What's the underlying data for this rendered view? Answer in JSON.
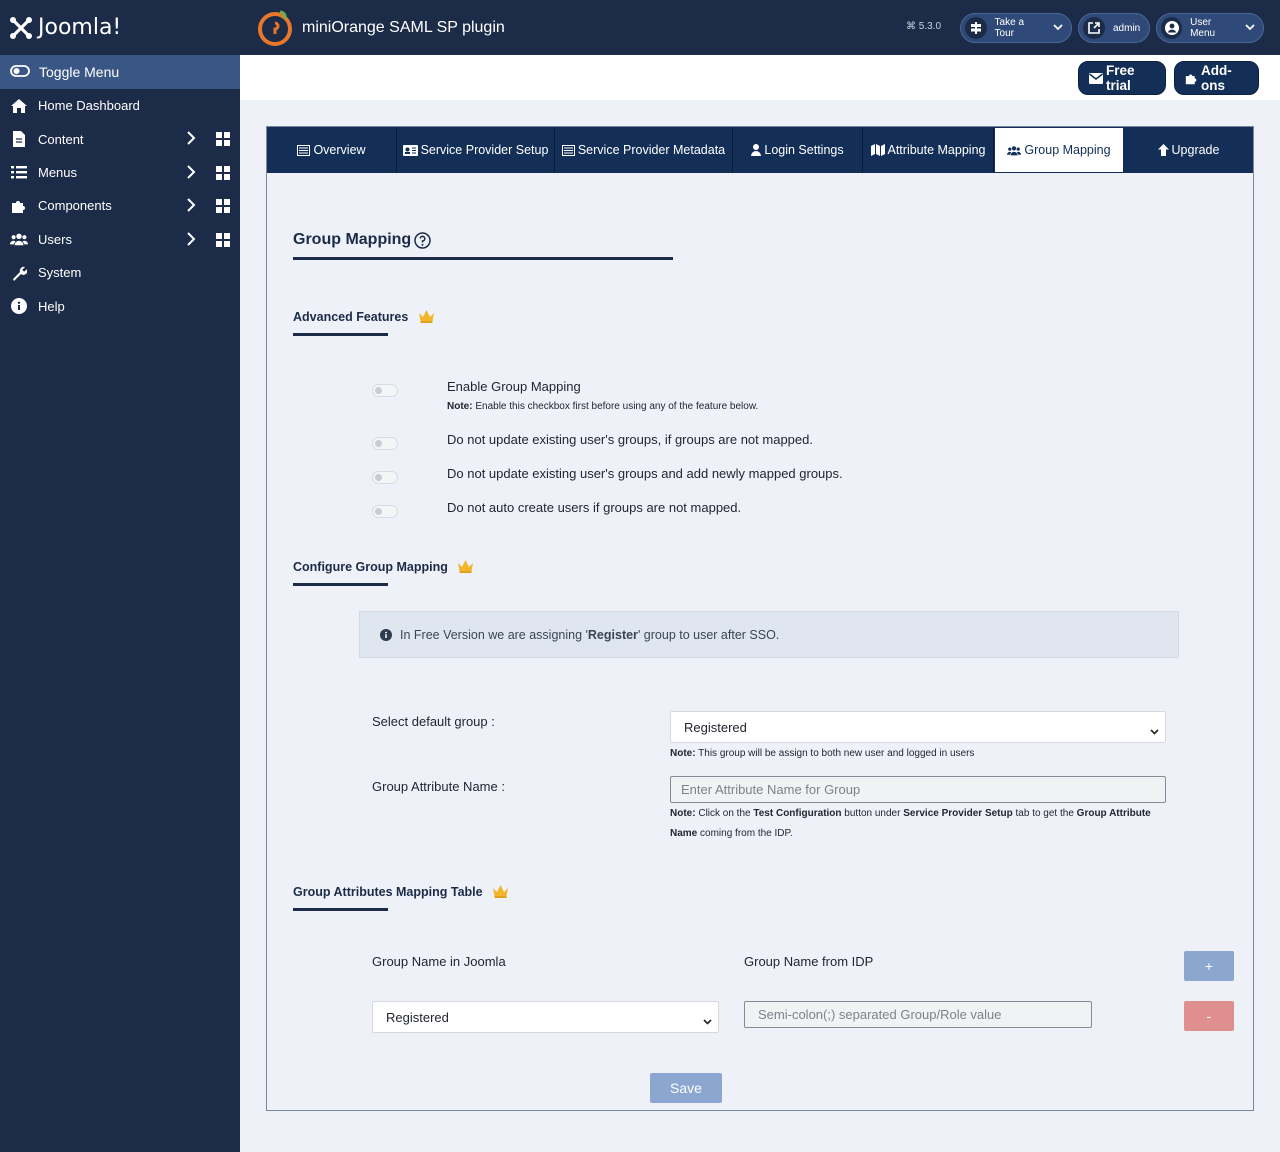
{
  "sidebar": {
    "brand": "Joomla!",
    "toggle_label": "Toggle Menu",
    "items": [
      {
        "label": "Home Dashboard"
      },
      {
        "label": "Content"
      },
      {
        "label": "Menus"
      },
      {
        "label": "Components"
      },
      {
        "label": "Users"
      },
      {
        "label": "System"
      },
      {
        "label": "Help"
      }
    ]
  },
  "header": {
    "title": "miniOrange SAML SP plugin",
    "version": "5.3.0",
    "take_tour": "Take a Tour",
    "admin": "admin",
    "user_menu": "User Menu"
  },
  "toolbar": {
    "free_trial": "Free trial",
    "add_ons": "Add-ons"
  },
  "tabs": [
    {
      "label": "Overview"
    },
    {
      "label": "Service Provider Setup"
    },
    {
      "label": "Service Provider Metadata"
    },
    {
      "label": "Login Settings"
    },
    {
      "label": "Attribute Mapping"
    },
    {
      "label": "Group Mapping"
    },
    {
      "label": "Upgrade"
    }
  ],
  "main": {
    "heading": "Group Mapping",
    "advanced_features": "Advanced Features",
    "enable_group_mapping": "Enable Group Mapping",
    "enable_note_label": "Note:",
    "enable_note_text": " Enable this checkbox first before using any of the feature below.",
    "opt1": "Do not update existing user's groups, if groups are not mapped.",
    "opt2": "Do not update existing user's groups and add newly mapped groups.",
    "opt3": "Do not auto create users if groups are not mapped.",
    "configure_heading": "Configure Group Mapping",
    "info_pre": "In Free Version we are assigning '",
    "info_bold": "Register",
    "info_post": "' group to user after SSO.",
    "default_group_label": "Select default group :",
    "default_group_value": "Registered",
    "default_note_label": "Note:",
    "default_note_text": " This group will be assign to both new user and logged in users",
    "attr_name_label": "Group Attribute Name :",
    "attr_name_placeholder": "Enter Attribute Name for Group",
    "attr_note_label": "Note:",
    "attr_note_1": " Click on the ",
    "attr_note_b1": "Test Configuration",
    "attr_note_2": " button under ",
    "attr_note_b2": "Service Provider Setup",
    "attr_note_3": " tab to get the ",
    "attr_note_b3": "Group Attribute Name",
    "attr_note_4": " coming from the IDP.",
    "table_heading": "Group Attributes Mapping Table",
    "col_joomla": "Group Name in Joomla",
    "col_idp": "Group Name from IDP",
    "row_group": "Registered",
    "row_placeholder": "Semi-colon(;) separated Group/Role value",
    "plus": "+",
    "minus": "-",
    "save": "Save"
  }
}
